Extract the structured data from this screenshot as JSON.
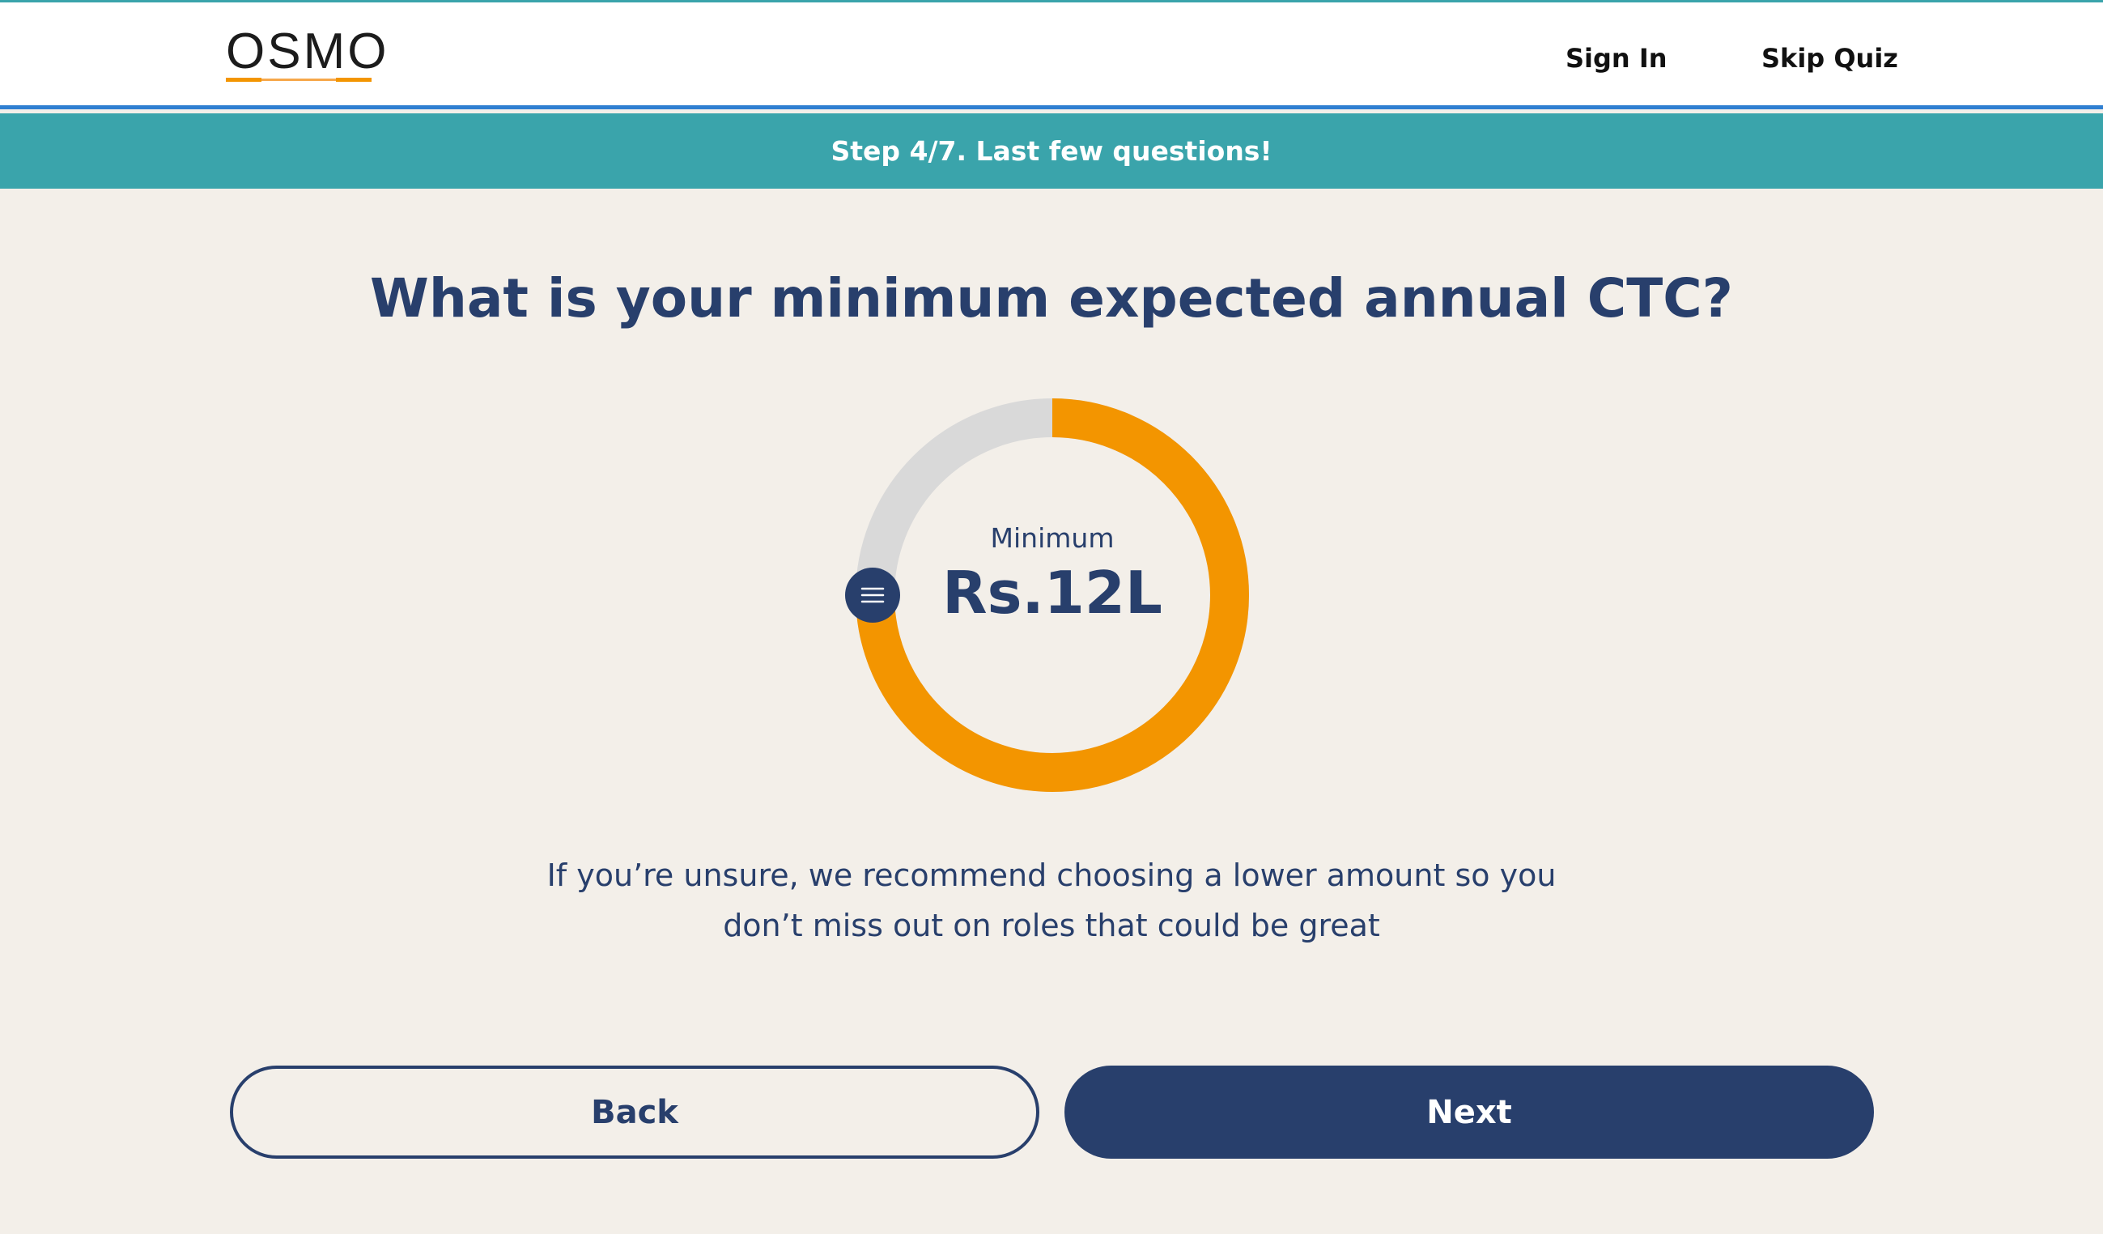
{
  "header": {
    "logo_text": "OSMO",
    "sign_in_label": "Sign In",
    "skip_quiz_label": "Skip Quiz"
  },
  "step_banner": {
    "text": "Step 4/7. Last few questions!"
  },
  "question": {
    "title": "What is your minimum expected annual CTC?"
  },
  "ctc_dial": {
    "label": "Minimum",
    "value_text": "Rs.12L",
    "fill_fraction": 0.75,
    "handle_icon": "menu-grip-icon"
  },
  "hint": {
    "line1": "If you’re unsure, we recommend choosing a lower amount so you",
    "line2": "don’t miss out on roles that could be great"
  },
  "actions": {
    "back_label": "Back",
    "next_label": "Next"
  },
  "colors": {
    "navy": "#283f6c",
    "teal": "#3aa4ab",
    "orange": "#f39500",
    "track_gray": "#d9d9d9",
    "background": "#f3efe9"
  }
}
